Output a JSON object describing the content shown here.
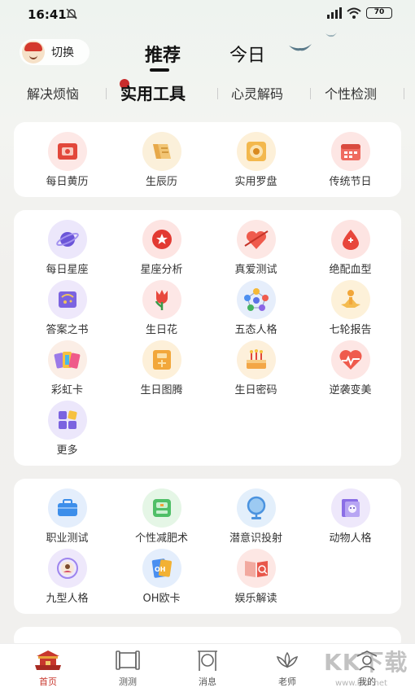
{
  "status": {
    "time": "16:41",
    "battery": "70"
  },
  "header": {
    "switch_label": "切换",
    "tab_recommend": "推荐",
    "tab_today": "今日"
  },
  "categories": [
    "解决烦恼",
    "实用工具",
    "心灵解码",
    "个性检测"
  ],
  "section1": [
    {
      "label": "每日黄历",
      "icon": "almanac-icon"
    },
    {
      "label": "生辰历",
      "icon": "scroll-icon"
    },
    {
      "label": "实用罗盘",
      "icon": "compass-icon"
    },
    {
      "label": "传统节日",
      "icon": "calendar-icon"
    }
  ],
  "section2": [
    {
      "label": "每日星座",
      "icon": "planet-icon"
    },
    {
      "label": "星座分析",
      "icon": "star-badge-icon"
    },
    {
      "label": "真爱测试",
      "icon": "heart-arrow-icon"
    },
    {
      "label": "绝配血型",
      "icon": "blood-drop-icon"
    },
    {
      "label": "答案之书",
      "icon": "book-icon"
    },
    {
      "label": "生日花",
      "icon": "tulip-icon"
    },
    {
      "label": "五态人格",
      "icon": "network-icon"
    },
    {
      "label": "七轮报告",
      "icon": "meditation-icon"
    },
    {
      "label": "彩虹卡",
      "icon": "rainbow-cards-icon"
    },
    {
      "label": "生日图腾",
      "icon": "totem-icon"
    },
    {
      "label": "生日密码",
      "icon": "cake-icon"
    },
    {
      "label": "逆袭变美",
      "icon": "heart-pulse-icon"
    },
    {
      "label": "更多",
      "icon": "more-grid-icon"
    }
  ],
  "section3": [
    {
      "label": "职业测试",
      "icon": "briefcase-icon"
    },
    {
      "label": "个性减肥术",
      "icon": "scale-icon"
    },
    {
      "label": "潜意识投射",
      "icon": "mirror-icon"
    },
    {
      "label": "动物人格",
      "icon": "animal-frame-icon"
    },
    {
      "label": "九型人格",
      "icon": "enneagram-icon"
    },
    {
      "label": "OH欧卡",
      "icon": "oh-card-icon"
    },
    {
      "label": "娱乐解读",
      "icon": "open-book-icon"
    }
  ],
  "bottom_nav": [
    {
      "label": "首页",
      "icon": "palace-icon",
      "active": true
    },
    {
      "label": "测测",
      "icon": "scroll-frame-icon",
      "active": false
    },
    {
      "label": "消息",
      "icon": "gong-icon",
      "active": false
    },
    {
      "label": "老师",
      "icon": "lotus-icon",
      "active": false
    },
    {
      "label": "我的",
      "icon": "person-icon",
      "active": false
    }
  ],
  "watermark": {
    "brand": "KK下载",
    "url": "www.kkx.net"
  },
  "colors": {
    "accent": "#c8372d",
    "card": "#ffffff",
    "background": "#f1f0ee"
  }
}
